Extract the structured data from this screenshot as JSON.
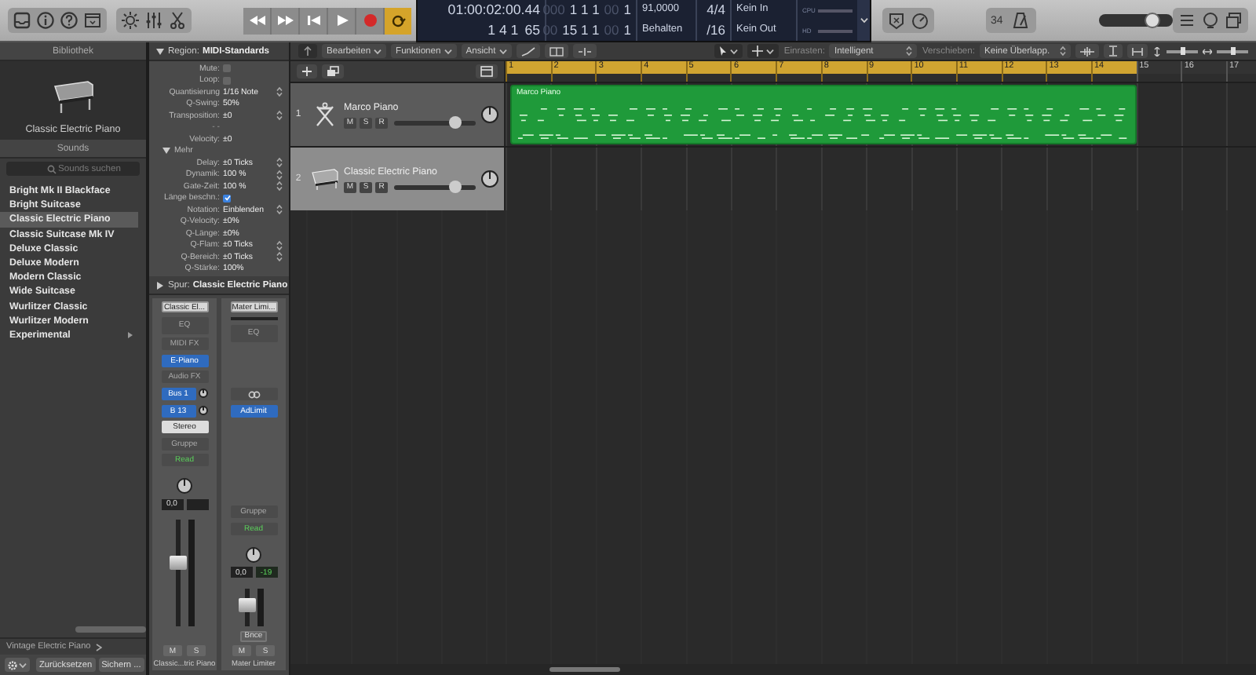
{
  "toolbar": {
    "cycle_on": true,
    "record_on": false,
    "lcd": {
      "columns": [
        {
          "kind": "text",
          "lines": [
            [
              {
                "text": "01:00:02:00.44",
                "dim": false
              }
            ],
            [
              {
                "text": "1 4 1",
                "dim": false
              },
              {
                "text": "65",
                "dim": false
              }
            ]
          ]
        },
        {
          "kind": "text",
          "lines": [
            [
              {
                "text": "000",
                "dim": true
              },
              {
                "text": "1 1 1",
                "dim": false
              },
              {
                "text": "00",
                "dim": true
              },
              {
                "text": "1",
                "dim": false
              }
            ],
            [
              {
                "text": "00",
                "dim": true
              },
              {
                "text": "15 1 1",
                "dim": false
              },
              {
                "text": "00",
                "dim": true
              },
              {
                "text": "1",
                "dim": false
              }
            ]
          ]
        },
        {
          "kind": "text",
          "lines": [
            [
              {
                "text": "91,0000",
                "dim": false
              }
            ],
            [
              {
                "text": "Behalten",
                "dim": false
              }
            ]
          ]
        },
        {
          "kind": "text",
          "lines": [
            [
              {
                "text": "4/4",
                "dim": false
              }
            ],
            [
              {
                "text": "/16",
                "dim": false
              }
            ]
          ]
        },
        {
          "kind": "text",
          "lines": [
            [
              {
                "text": "Kein In",
                "dim": false
              }
            ],
            [
              {
                "text": "Kein Out",
                "dim": false
              }
            ]
          ]
        },
        {
          "kind": "meters",
          "labels": [
            "CPU",
            "HD"
          ]
        }
      ]
    },
    "count_in": "34",
    "master_volume": {
      "level": 0.78
    }
  },
  "library": {
    "title": "Bibliothek",
    "preview_name": "Classic Electric Piano",
    "sounds_title": "Sounds",
    "search": {
      "placeholder": "Sounds suchen"
    },
    "items": [
      {
        "label": "Bright Mk II Blackface",
        "selected": false,
        "has_children": false
      },
      {
        "label": "Bright Suitcase",
        "selected": false,
        "has_children": false
      },
      {
        "label": "Classic Electric Piano",
        "selected": true,
        "has_children": false
      },
      {
        "label": "Classic Suitcase Mk IV",
        "selected": false,
        "has_children": false
      },
      {
        "label": "Deluxe Classic",
        "selected": false,
        "has_children": false
      },
      {
        "label": "Deluxe Modern",
        "selected": false,
        "has_children": false
      },
      {
        "label": "Modern Classic",
        "selected": false,
        "has_children": false
      },
      {
        "label": "Wide Suitcase",
        "selected": false,
        "has_children": false
      },
      {
        "label": "Wurlitzer Classic",
        "selected": false,
        "has_children": false
      },
      {
        "label": "Wurlitzer Modern",
        "selected": false,
        "has_children": false
      },
      {
        "label": "Experimental",
        "selected": false,
        "has_children": true
      }
    ],
    "path": "Vintage Electric Piano",
    "buttons": [
      "Zurücksetzen",
      "Sichern ..."
    ]
  },
  "inspector": {
    "region": {
      "label": "Region:",
      "value": "MIDI-Standards",
      "expanded": true
    },
    "params": [
      {
        "kind": "check",
        "label": "Mute:",
        "checked": false
      },
      {
        "kind": "check",
        "label": "Loop:",
        "checked": false
      },
      {
        "kind": "select",
        "label": "Quantisierung",
        "value": "1/16 Note"
      },
      {
        "kind": "value",
        "label": "Q-Swing:",
        "value": "50%"
      },
      {
        "kind": "select",
        "label": "Transposition:",
        "value": "±0"
      },
      {
        "kind": "note",
        "text": "- -"
      },
      {
        "kind": "value",
        "label": "Velocity:",
        "value": "±0"
      },
      {
        "kind": "section",
        "label": "Mehr",
        "expanded": true
      },
      {
        "kind": "select",
        "label": "Delay:",
        "value": "±0 Ticks"
      },
      {
        "kind": "select",
        "label": "Dynamik:",
        "value": "100 %"
      },
      {
        "kind": "select",
        "label": "Gate-Zeit:",
        "value": "100 %"
      },
      {
        "kind": "check",
        "label": "Länge beschn.:",
        "checked": true
      },
      {
        "kind": "select",
        "label": "Notation:",
        "value": "Einblenden"
      },
      {
        "kind": "value",
        "label": "Q-Velocity:",
        "value": "±0%"
      },
      {
        "kind": "value",
        "label": "Q-Länge:",
        "value": "±0%"
      },
      {
        "kind": "select",
        "label": "Q-Flam:",
        "value": "±0 Ticks"
      },
      {
        "kind": "select",
        "label": "Q-Bereich:",
        "value": "±0 Ticks"
      },
      {
        "kind": "value",
        "label": "Q-Stärke:",
        "value": "100%"
      }
    ],
    "track": {
      "label": "Spur:",
      "value": "Classic Electric Piano",
      "expanded": false
    },
    "strips": [
      {
        "setting": "Classic El...",
        "slots": [
          {
            "kind": "eq",
            "text": "EQ"
          },
          {
            "kind": "label",
            "text": "MIDI FX"
          },
          {
            "kind": "plugin",
            "text": "E-Piano"
          },
          {
            "kind": "label",
            "text": "Audio FX"
          },
          {
            "kind": "send",
            "text": "Bus 1"
          },
          {
            "kind": "send",
            "text": "B 13"
          },
          {
            "kind": "output",
            "text": "Stereo"
          },
          {
            "kind": "label",
            "text": "Gruppe"
          },
          {
            "kind": "automation",
            "text": "Read"
          }
        ],
        "volume": "0,0",
        "fader": {
          "level": 0.62
        },
        "buttons": [
          "M",
          "S"
        ],
        "name": "Classic...tric Piano"
      },
      {
        "setting": "Mater Limi...",
        "slots": [
          {
            "kind": "bar"
          },
          {
            "kind": "eq",
            "text": "EQ"
          },
          {
            "kind": "empty"
          },
          {
            "kind": "link"
          },
          {
            "kind": "plugin",
            "text": "AdLimit"
          },
          {
            "kind": "empty"
          },
          {
            "kind": "empty"
          },
          {
            "kind": "label",
            "text": "Gruppe"
          },
          {
            "kind": "automation",
            "text": "Read"
          }
        ],
        "volume": "0,0",
        "peak": "-19",
        "fader": {
          "level": 0.62
        },
        "bounce": "Bnce",
        "buttons": [
          "M",
          "S"
        ],
        "name": "Mater Limiter"
      }
    ]
  },
  "arrange": {
    "menus": [
      "Bearbeiten",
      "Funktionen",
      "Ansicht"
    ],
    "snap": {
      "label": "Einrasten:",
      "value": "Intelligent"
    },
    "drag": {
      "label": "Verschieben:",
      "value": "Keine Überlapp."
    },
    "zoom": [
      {
        "level": 0.55
      },
      {
        "level": 0.5
      }
    ],
    "bars": [
      {
        "label": "1",
        "in_cycle": true
      },
      {
        "label": "2",
        "in_cycle": true
      },
      {
        "label": "3",
        "in_cycle": true
      },
      {
        "label": "4",
        "in_cycle": true
      },
      {
        "label": "5",
        "in_cycle": true
      },
      {
        "label": "6",
        "in_cycle": true
      },
      {
        "label": "7",
        "in_cycle": true
      },
      {
        "label": "8",
        "in_cycle": true
      },
      {
        "label": "9",
        "in_cycle": true
      },
      {
        "label": "10",
        "in_cycle": true
      },
      {
        "label": "11",
        "in_cycle": true
      },
      {
        "label": "12",
        "in_cycle": true
      },
      {
        "label": "13",
        "in_cycle": true
      },
      {
        "label": "14",
        "in_cycle": true
      },
      {
        "label": "15",
        "in_cycle": false
      },
      {
        "label": "16",
        "in_cycle": false
      },
      {
        "label": "17",
        "in_cycle": false
      }
    ],
    "tracks": [
      {
        "number": "1",
        "name": "Marco Piano",
        "kind": "stand",
        "selected": false,
        "volume": {
          "level": 0.8
        },
        "buttons": [
          "M",
          "S",
          "R"
        ],
        "regions": [
          {
            "name": "Marco Piano"
          }
        ]
      },
      {
        "number": "2",
        "name": "Classic Electric Piano",
        "kind": "piano",
        "selected": true,
        "volume": {
          "level": 0.8
        },
        "buttons": [
          "M",
          "S",
          "R"
        ]
      }
    ]
  }
}
